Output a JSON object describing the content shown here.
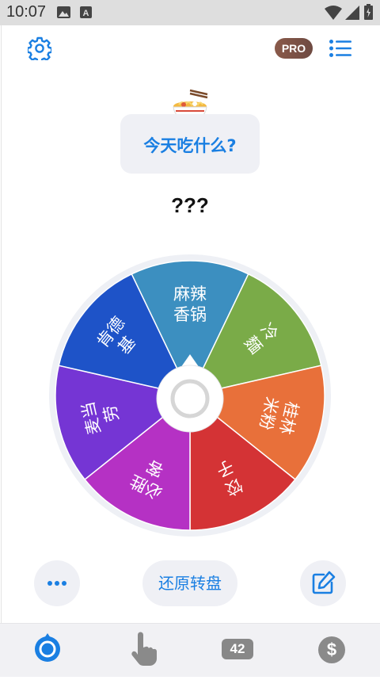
{
  "status_bar": {
    "time": "10:07"
  },
  "header": {
    "pro_label": "PRO"
  },
  "question": {
    "text": "今天吃什么?"
  },
  "result": {
    "text": "???"
  },
  "wheel": {
    "slices": [
      {
        "label": "麻辣\n香锅",
        "color": "#3c8fc0"
      },
      {
        "label": "冷\n麵",
        "color": "#7aab48"
      },
      {
        "label": "桂林\n米粉",
        "color": "#e8703a"
      },
      {
        "label": "饺\n子",
        "color": "#d43335"
      },
      {
        "label": "必胜\n客",
        "color": "#b531c4"
      },
      {
        "label": "麦当\n劳",
        "color": "#7535d4"
      },
      {
        "label": "肯德\n基",
        "color": "#1e53c8"
      }
    ]
  },
  "actions": {
    "reset_label": "还原转盘"
  },
  "bottom_nav": {
    "count_badge": "42",
    "coin_symbol": "$"
  },
  "colors": {
    "accent": "#1a7fe2"
  }
}
